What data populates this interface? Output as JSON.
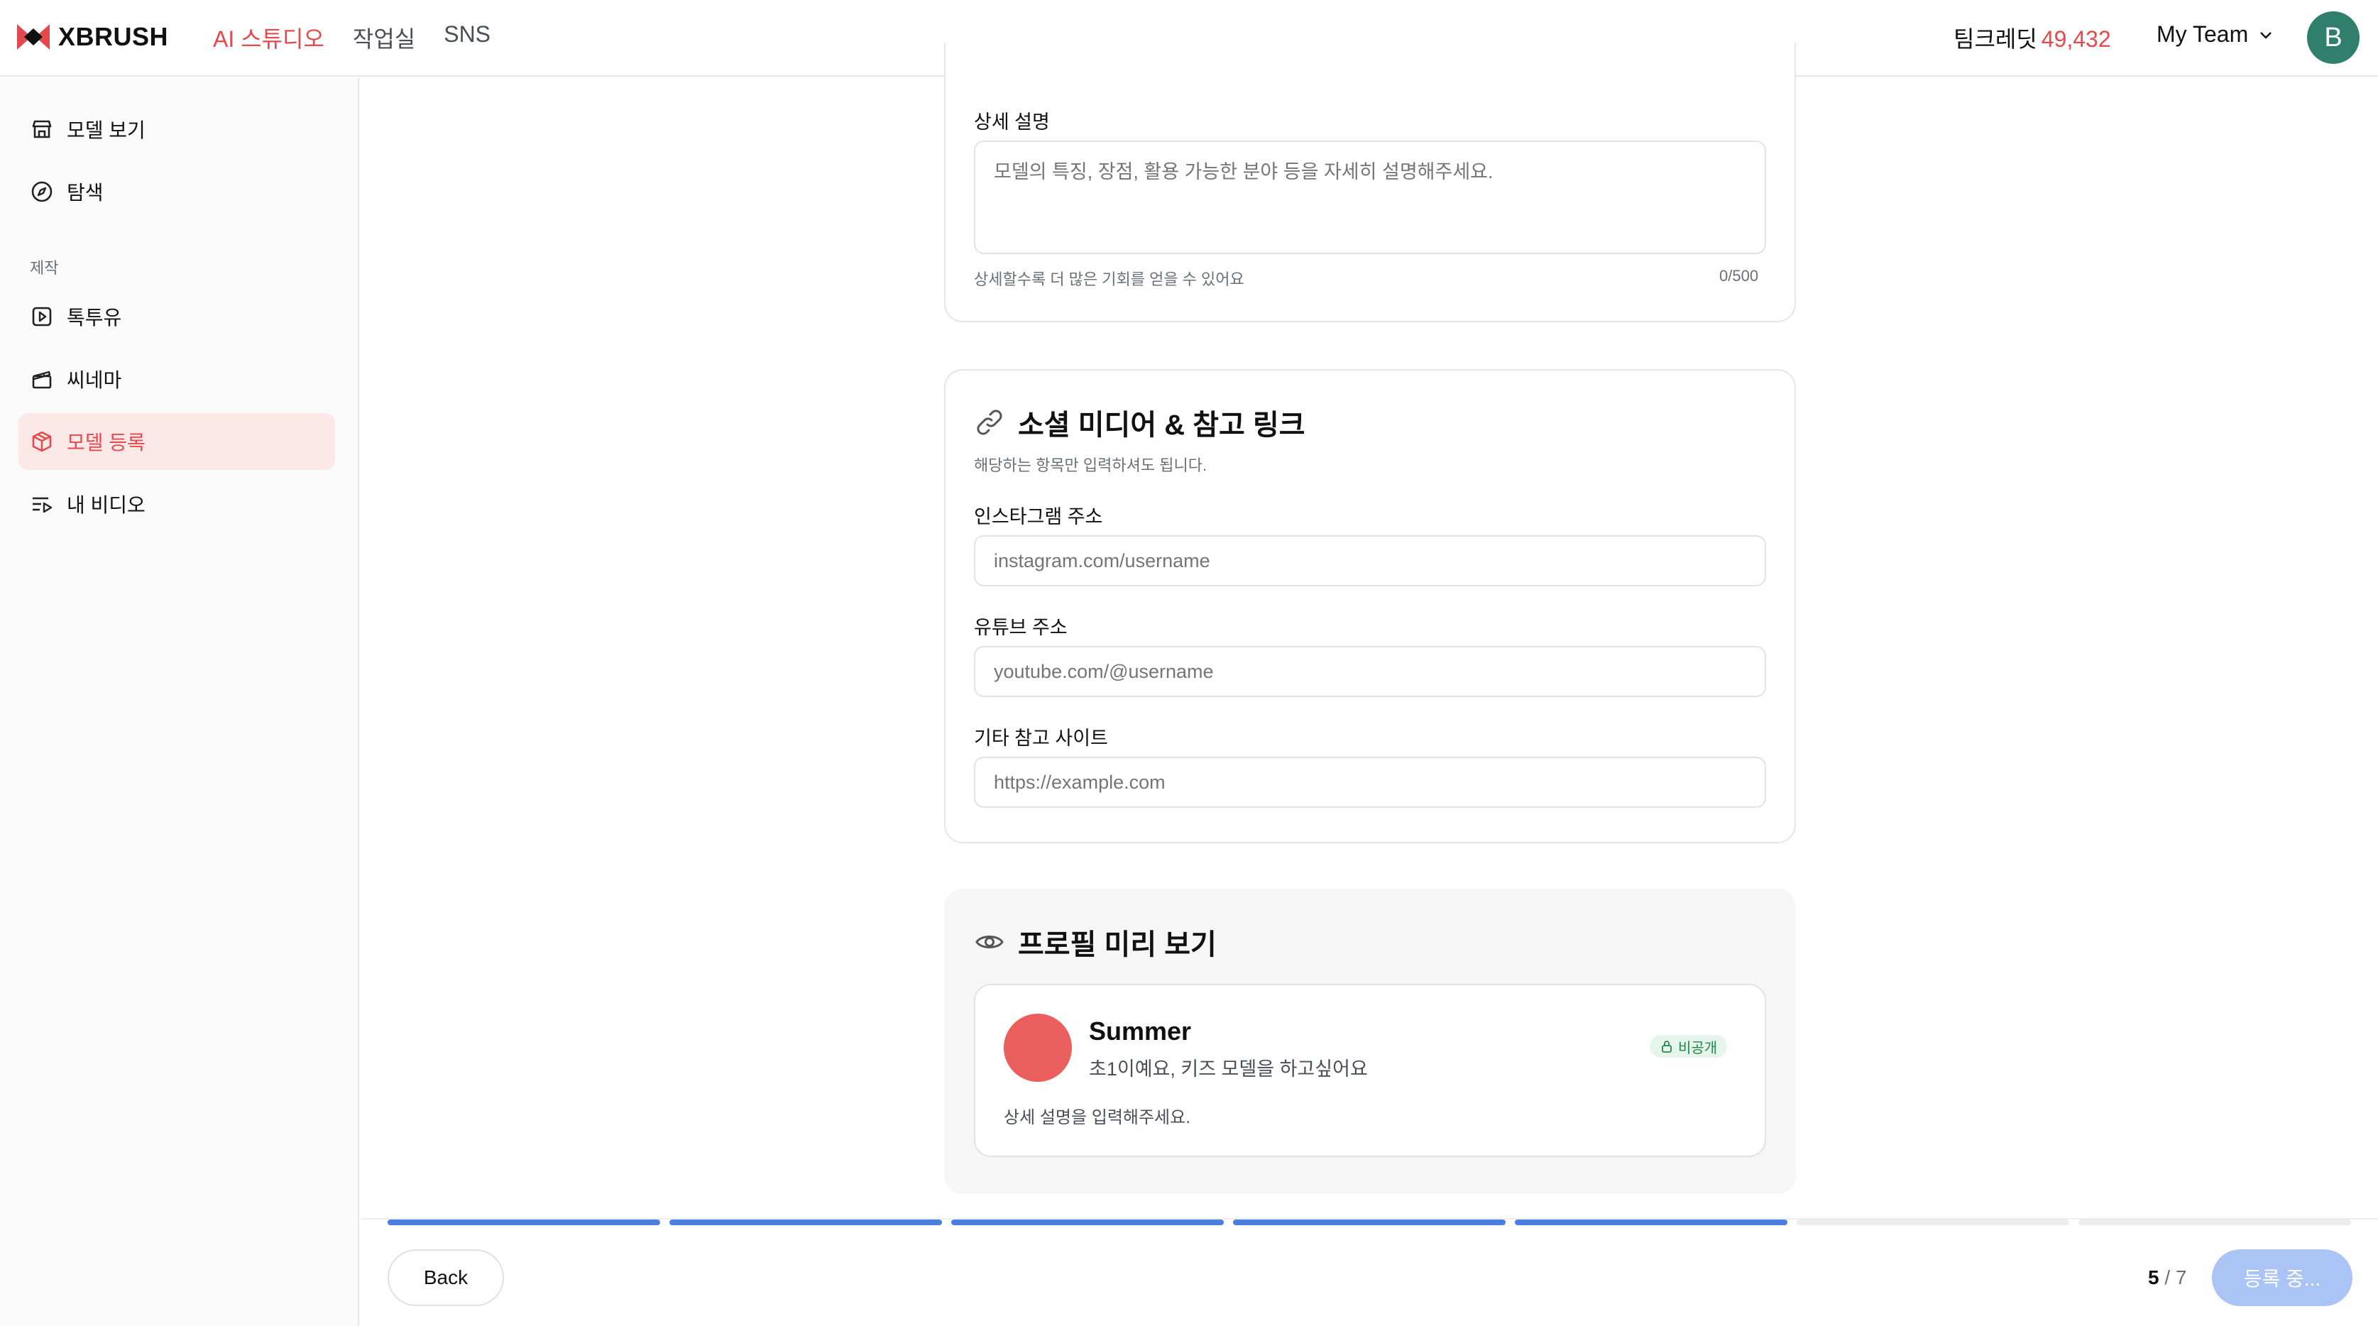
{
  "header": {
    "brand": "XBRUSH",
    "nav": [
      {
        "label": "AI 스튜디오",
        "active": true
      },
      {
        "label": "작업실",
        "active": false
      },
      {
        "label": "SNS",
        "active": false
      }
    ],
    "credit_label": "팀크레딧",
    "credit_amount": "49,432",
    "team_label": "My Team",
    "avatar_initial": "B"
  },
  "sidebar": {
    "items_top": [
      {
        "label": "모델 보기",
        "icon": "store-icon"
      },
      {
        "label": "탐색",
        "icon": "compass-icon"
      }
    ],
    "section_label": "제작",
    "items_make": [
      {
        "label": "톡투유",
        "icon": "play-square-icon"
      },
      {
        "label": "씨네마",
        "icon": "clapperboard-icon"
      },
      {
        "label": "모델 등록",
        "icon": "box-icon",
        "active": true
      },
      {
        "label": "내 비디오",
        "icon": "list-video-icon"
      }
    ]
  },
  "detail": {
    "label": "상세 설명",
    "placeholder": "모델의 특징, 장점, 활용 가능한 분야 등을 자세히 설명해주세요.",
    "hint": "상세할수록 더 많은 기회를 얻을 수 있어요",
    "counter": "0/500"
  },
  "social": {
    "title": "소셜 미디어 & 참고 링크",
    "subtitle": "해당하는 항목만 입력하셔도 됩니다.",
    "instagram_label": "인스타그램 주소",
    "instagram_placeholder": "instagram.com/username",
    "youtube_label": "유튜브 주소",
    "youtube_placeholder": "youtube.com/@username",
    "other_label": "기타 참고 사이트",
    "other_placeholder": "https://example.com"
  },
  "preview": {
    "title": "프로필 미리 보기",
    "name": "Summer",
    "intro": "초1이예요, 키즈 모델을 하고싶어요",
    "badge": "비공개",
    "description": "상세 설명을 입력해주세요."
  },
  "footer": {
    "back_label": "Back",
    "step_current": "5",
    "step_total": "/ 7",
    "submit_label": "등록 중...",
    "progress_completed": 5,
    "progress_total": 7
  },
  "colors": {
    "accent": "#e5484d",
    "progress_active": "#4a7fe0",
    "progress_inactive": "#ededed",
    "submit_disabled": "#a9c4f5"
  }
}
